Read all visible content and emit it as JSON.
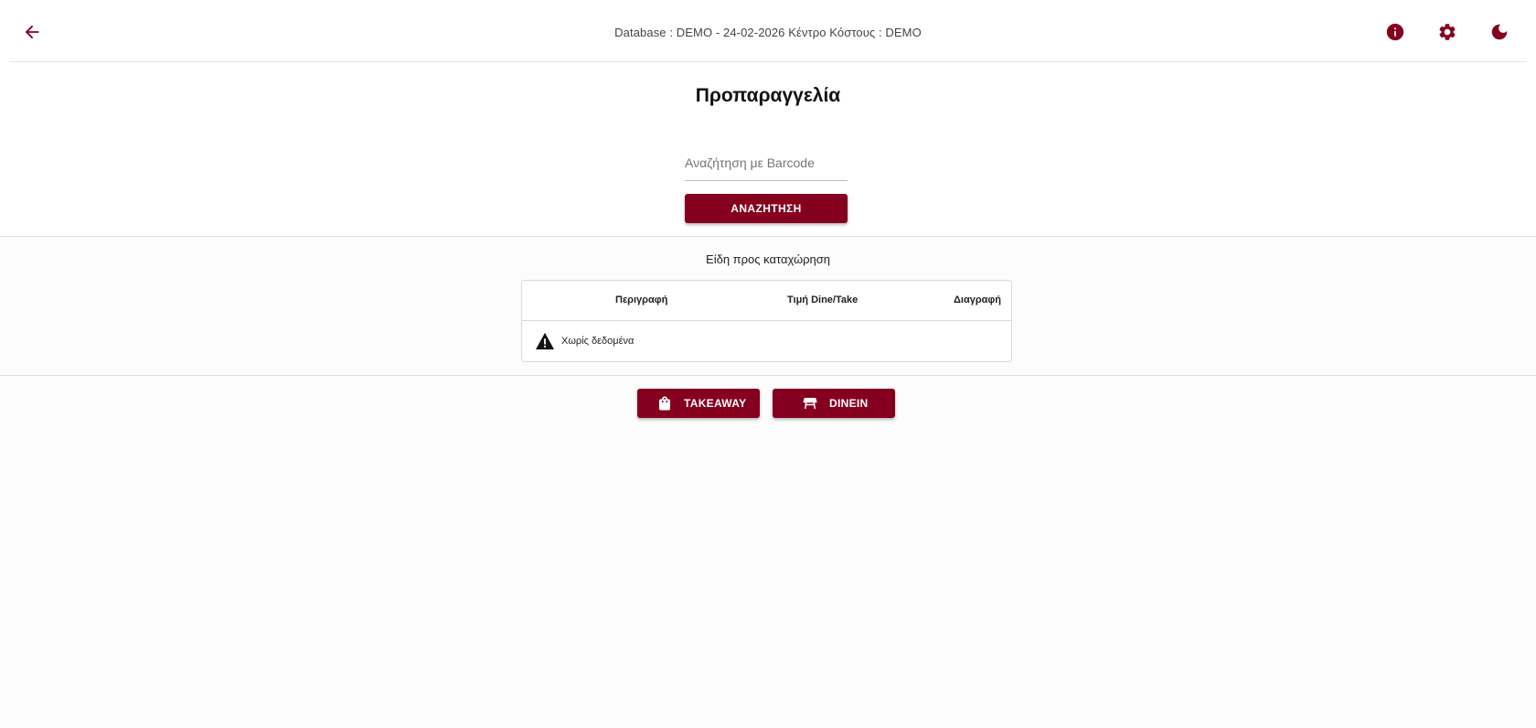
{
  "header": {
    "db_info": "Database : DEMO - 24-02-2026 Κέντρο Κόστους : DEMO",
    "icons": [
      "arrow-left-icon",
      "info-icon",
      "gear-icon",
      "moon-icon"
    ]
  },
  "main": {
    "title": "Προπαραγγελία",
    "search": {
      "placeholder": "Αναζήτηση με Barcode",
      "value": "",
      "button_label": "ΑΝΑΖΗΤΗΣΗ"
    },
    "items_section": {
      "label": "Είδη προς καταχώρηση",
      "columns": [
        "Περιγραφή",
        "Τιμή Dine/Take",
        "Διαγραφή"
      ],
      "rows": [],
      "empty_text": "Χωρίς δεδομένα"
    },
    "actions": {
      "takeaway_label": "TAKEAWAY",
      "dinein_label": "DINEIN"
    }
  },
  "colors": {
    "accent": "#85001f",
    "background": "#fcfcfc",
    "header_background": "#ffffff"
  }
}
